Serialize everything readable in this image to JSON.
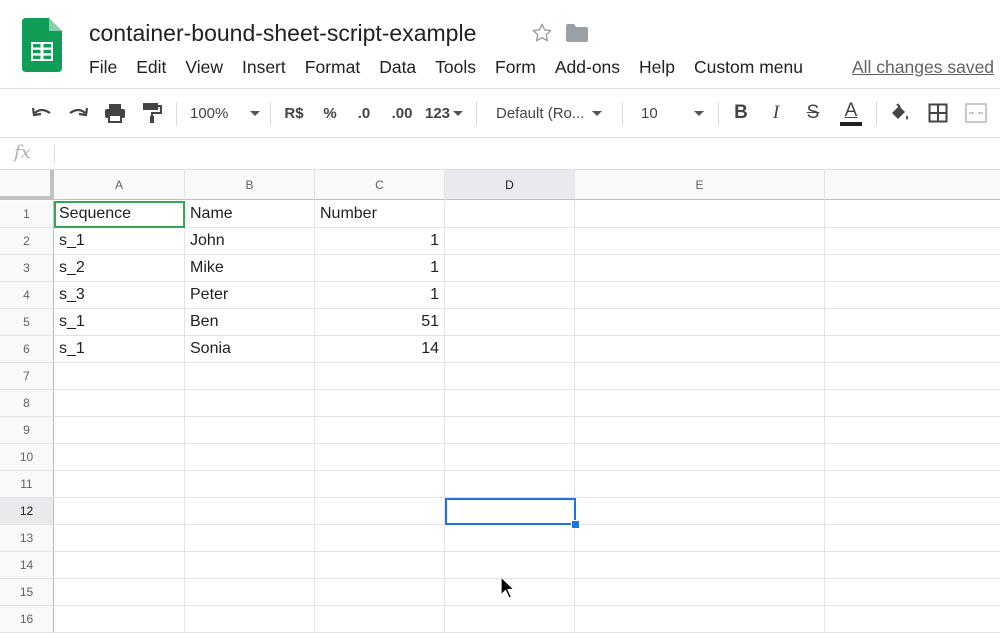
{
  "app": {
    "doc_title": "container-bound-sheet-script-example",
    "save_status": "All changes saved",
    "brand_color": "#0f9d58"
  },
  "menu": [
    "File",
    "Edit",
    "View",
    "Insert",
    "Format",
    "Data",
    "Tools",
    "Form",
    "Add-ons",
    "Help",
    "Custom menu"
  ],
  "toolbar": {
    "zoom": "100%",
    "currency": "R$",
    "percent": "%",
    "decimal_decrease": ".0",
    "decimal_increase": ".00",
    "number_format": "123",
    "font_family": "Default (Ro...",
    "font_size": "10",
    "bold": "B",
    "italic": "I",
    "strikethrough": "S",
    "text_color": "A"
  },
  "formula_bar": {
    "fx": "fx",
    "value": ""
  },
  "grid": {
    "columns": [
      "A",
      "B",
      "C",
      "D",
      "E"
    ],
    "rows": [
      "1",
      "2",
      "3",
      "4",
      "5",
      "6",
      "7",
      "8",
      "9",
      "10",
      "11",
      "12",
      "13",
      "14",
      "15",
      "16"
    ],
    "cells": [
      [
        "Sequence",
        "Name",
        "Number"
      ],
      [
        "s_1",
        "John",
        "1"
      ],
      [
        "s_2",
        "Mike",
        "1"
      ],
      [
        "s_3",
        "Peter",
        "1"
      ],
      [
        "s_1",
        "Ben",
        "51"
      ],
      [
        "s_1",
        "Sonia",
        "14"
      ]
    ],
    "selected_cell": "D12",
    "selection_color": "#1a73e8"
  }
}
